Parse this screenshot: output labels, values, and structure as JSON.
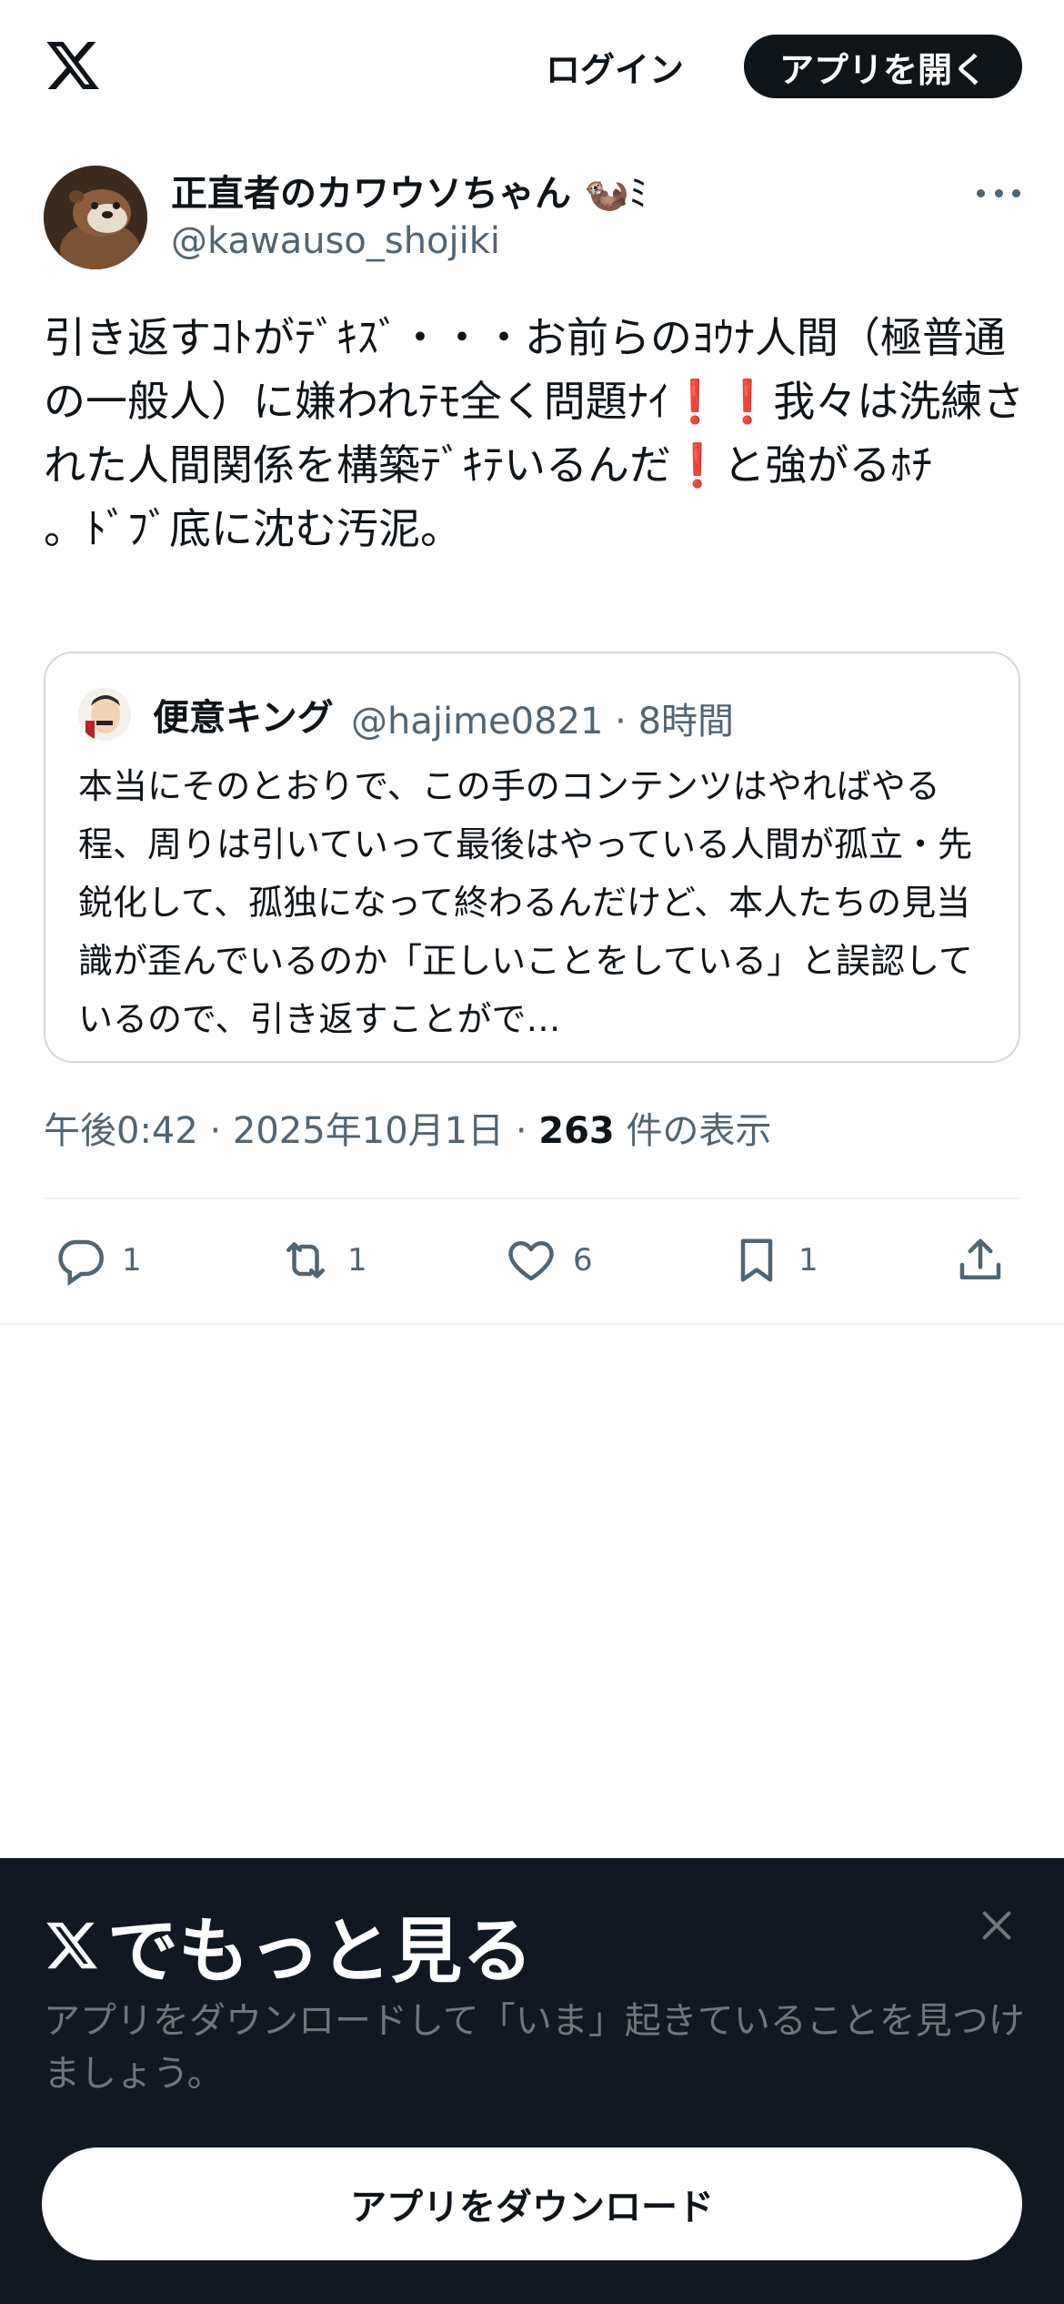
{
  "header": {
    "login_label": "ログイン",
    "open_app_label": "アプリを開く"
  },
  "tweet": {
    "display_name": "正直者のカワウソちゃん",
    "display_name_emoji": "🦦ﾐ",
    "handle": "@kawauso_shojiki",
    "text": "引き返すｺﾄがﾃﾞｷｽﾞ・・・お前らのﾖｳﾅ人間（極普通の一般人）に嫌われﾃﾓ全く問題ﾅｲ❗❗我々は洗練された人間関係を構築ﾃﾞｷﾃいるんだ❗と強がるﾎﾁ\n。ﾄﾞﾌﾞ底に沈む汚泥。",
    "timestamp_prefix": "午後0:42 · 2025年10月1日 · ",
    "views_count": "263",
    "views_suffix": " 件の表示"
  },
  "quote": {
    "name": "便意キング",
    "meta": "@hajime0821 · 8時間",
    "text": "本当にそのとおりで、この手のコンテンツはやればやる程、周りは引いていって最後はやっている人間が孤立・先鋭化して、孤独になって終わるんだけど、本人たちの見当識が歪んでいるのか「正しいことをしている」と誤認しているので、引き返すことがで…"
  },
  "actions": {
    "replies": "1",
    "reposts": "1",
    "likes": "6",
    "bookmarks": "1"
  },
  "sheet": {
    "title": "でもっと見る",
    "subtitle": "アプリをダウンロードして「いま」起きていることを見つけましょう。",
    "download_label": "アプリをダウンロード"
  },
  "icons": {
    "logo": "x-logo-icon",
    "more": "more-icon",
    "reply": "reply-icon",
    "repost": "repost-icon",
    "like": "heart-icon",
    "bookmark": "bookmark-icon",
    "share": "share-icon",
    "close": "close-icon"
  },
  "colors": {
    "text": "#0f1419",
    "secondary": "#536471",
    "sheet_bg": "#111821",
    "border": "#cfd9de"
  }
}
